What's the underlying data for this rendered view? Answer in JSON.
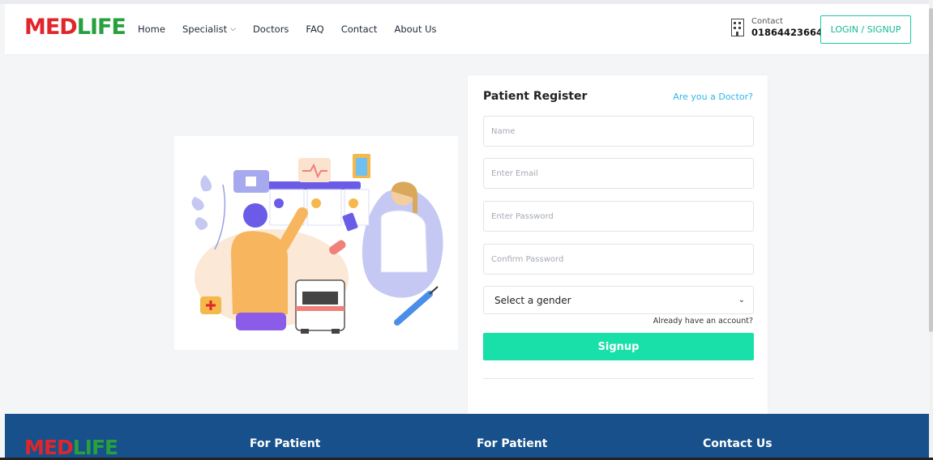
{
  "brand": {
    "logo_part1": "MED",
    "logo_part2": "LIFE"
  },
  "nav": {
    "items": [
      {
        "label": "Home"
      },
      {
        "label": "Specialist"
      },
      {
        "label": "Doctors"
      },
      {
        "label": "FAQ"
      },
      {
        "label": "Contact"
      },
      {
        "label": "About Us"
      }
    ]
  },
  "contact": {
    "label": "Contact",
    "number": "01864423664"
  },
  "login": {
    "label": "LOGIN / SIGNUP"
  },
  "form": {
    "title": "Patient Register",
    "doctor_link": "Are you a Doctor?",
    "name_placeholder": "Name",
    "email_placeholder": "Enter Email",
    "password_placeholder": "Enter Password",
    "confirm_placeholder": "Confirm Password",
    "gender_selected": "Select a gender",
    "already": "Already have an account?",
    "signup": "Signup"
  },
  "footer": {
    "col1": "For Patient",
    "col2": "For Patient",
    "col3": "Contact Us"
  },
  "colors": {
    "accent": "#19e0a9",
    "link": "#2bb6e5",
    "footer": "#17508a",
    "logo_red": "#e0262b",
    "logo_green": "#27a03d"
  }
}
